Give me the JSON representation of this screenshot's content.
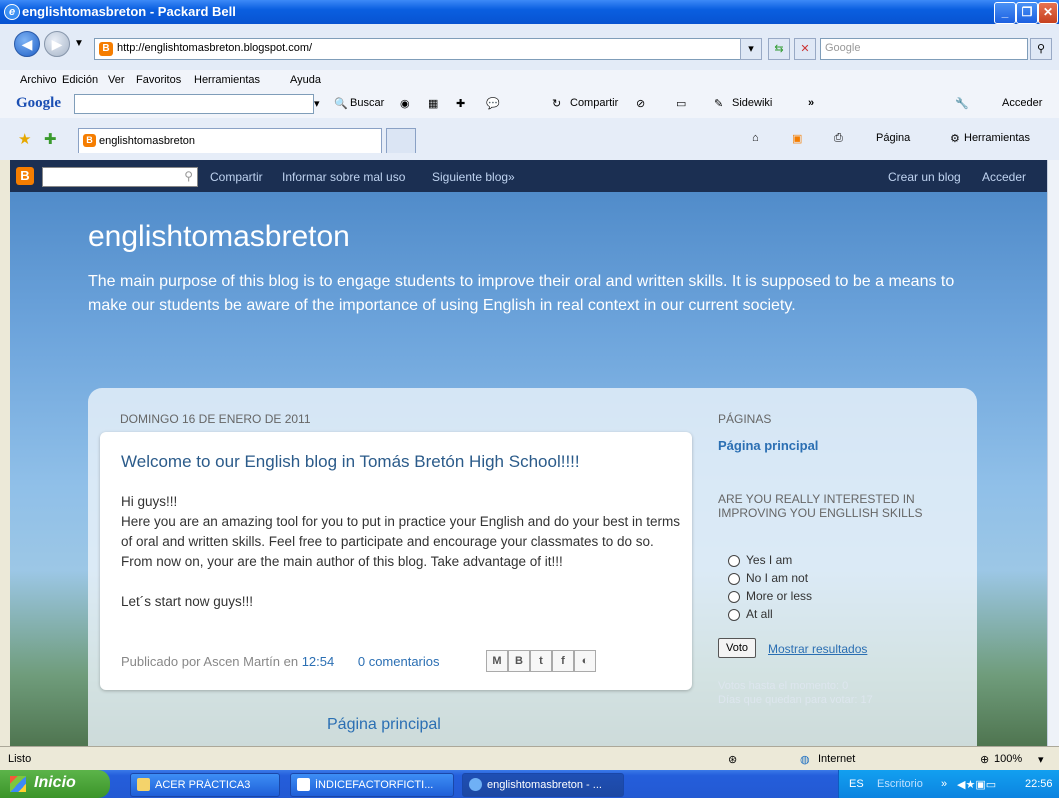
{
  "window": {
    "title": "englishtomasbreton - Packard Bell"
  },
  "address": {
    "url": "http://englishtomasbreton.blogspot.com/",
    "search_placeholder": "Google"
  },
  "menu": [
    "Archivo",
    "Edición",
    "Ver",
    "Favoritos",
    "Herramientas",
    "Ayuda"
  ],
  "google_toolbar": {
    "logo": "Google",
    "buscar": "Buscar",
    "compartir": "Compartir",
    "sidewiki": "Sidewiki",
    "more": "»",
    "acceder": "Acceder"
  },
  "favorites": {
    "tab_label": "englishtomasbreton",
    "pagina": "Página",
    "herramientas": "Herramientas"
  },
  "blogger_bar": {
    "compartir": "Compartir",
    "informar": "Informar sobre mal uso",
    "siguiente": "Siguiente blog»",
    "crear": "Crear un blog",
    "acceder": "Acceder"
  },
  "blog": {
    "title": "englishtomasbreton",
    "description": "The main purpose of this blog is to engage students to improve their oral and written skills. It is supposed to be a means to make our students be aware of the importance of using English in real context in our current society.",
    "date": "DOMINGO 16 DE ENERO DE 2011",
    "post": {
      "title": "Welcome to our English blog in Tomás Bretón High School!!!!",
      "lines": [
        "Hi guys!!!",
        "Here you are an amazing tool for you to put in practice your English and do your best in terms of oral and written skills. Feel free to participate and encourage your classmates to do so.",
        "From now on, your are the main author of this blog. Take advantage of it!!!",
        "",
        "Let´s start now guys!!!"
      ],
      "published_by": "Publicado por Ascen Martín en",
      "time": "12:54",
      "comments": "0 comentarios"
    },
    "home_link": "Página principal"
  },
  "sidebar": {
    "pages_header": "PÁGINAS",
    "pages_link": "Página principal",
    "poll_header": "ARE YOU REALLY INTERESTED IN IMPROVING YOU ENGLLISH SKILLS",
    "options": [
      "Yes I am",
      "No I am not",
      "More or less",
      "At all"
    ],
    "vote_button": "Voto",
    "results_link": "Mostrar resultados",
    "votes_so_far": "Votos hasta el momento: 0",
    "days_left": "Días que quedan para votar: 17"
  },
  "status": {
    "text": "Listo",
    "zone": "Internet",
    "zoom": "100%"
  },
  "taskbar": {
    "start": "Inicio",
    "tasks": [
      "ACER PRÁCTICA3",
      "ÍNDICEFACTORFICTI...",
      "englishtomasbreton - ..."
    ],
    "lang": "ES",
    "desktop": "Escritorio",
    "clock": "22:56"
  }
}
